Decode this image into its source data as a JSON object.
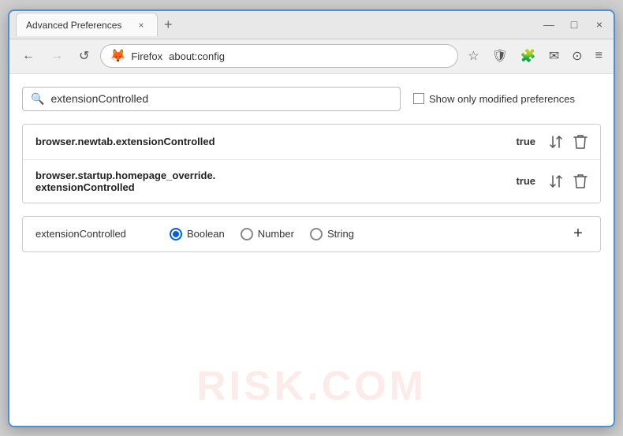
{
  "window": {
    "title": "Advanced Preferences",
    "tab_close": "×",
    "new_tab": "+",
    "win_minimize": "—",
    "win_maximize": "□",
    "win_close": "×"
  },
  "nav": {
    "back_label": "←",
    "forward_label": "→",
    "reload_label": "↺",
    "browser_name": "Firefox",
    "url": "about:config",
    "bookmark_icon": "☆",
    "shield_icon": "🛡",
    "ext_icon": "🧩",
    "mail_icon": "✉",
    "account_icon": "⊙",
    "menu_icon": "≡"
  },
  "search": {
    "placeholder": "extensionControlled",
    "value": "extensionControlled",
    "show_modified_label": "Show only modified preferences"
  },
  "results": [
    {
      "name": "browser.newtab.extensionControlled",
      "value": "true"
    },
    {
      "name": "browser.startup.homepage_override.\nextensionControlled",
      "name_line1": "browser.startup.homepage_override.",
      "name_line2": "extensionControlled",
      "value": "true",
      "multiline": true
    }
  ],
  "add_pref": {
    "name": "extensionControlled",
    "type_options": [
      {
        "label": "Boolean",
        "selected": true
      },
      {
        "label": "Number",
        "selected": false
      },
      {
        "label": "String",
        "selected": false
      }
    ],
    "add_btn": "+"
  },
  "watermark": "RISK.COM"
}
